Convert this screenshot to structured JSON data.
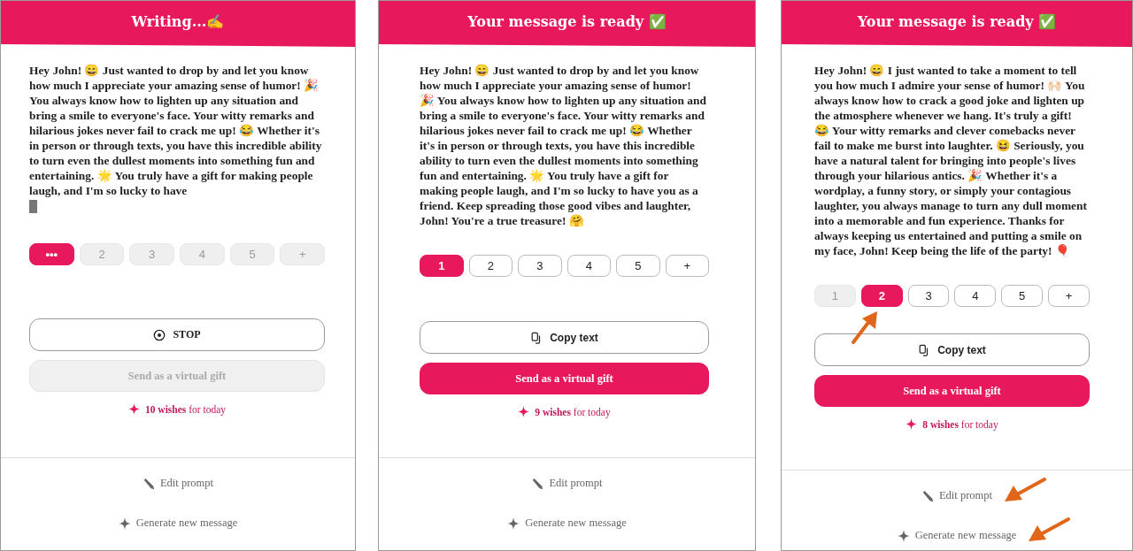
{
  "screens": [
    {
      "title": "Writing...✍️",
      "message": "Hey John! 😄 Just wanted to drop by and let you know how much I appreciate your amazing sense of humor! 🎉 You always know how to lighten up any situation and bring a smile to everyone's face. Your witty remarks and hilarious jokes never fail to crack me up! 😂 Whether it's in person or through texts, you have this incredible ability to turn even the dullest moments into something fun and entertaining. 🌟 You truly have a gift for making people laugh, and I'm so lucky to have",
      "typing": true,
      "versions": [
        {
          "label": "•••",
          "selected": true,
          "disabled": false
        },
        {
          "label": "2",
          "selected": false,
          "disabled": true
        },
        {
          "label": "3",
          "selected": false,
          "disabled": true
        },
        {
          "label": "4",
          "selected": false,
          "disabled": true
        },
        {
          "label": "5",
          "selected": false,
          "disabled": true
        },
        {
          "label": "+",
          "selected": false,
          "disabled": true
        }
      ],
      "action": {
        "kind": "stop",
        "label": "STOP"
      },
      "gift": {
        "label": "Send as a virtual gift",
        "disabled": true
      },
      "wishes": "**10 wishes** for today",
      "links": [
        {
          "kind": "edit",
          "label": "Edit prompt"
        },
        {
          "kind": "generate",
          "label": "Generate new message"
        }
      ]
    },
    {
      "title": "Your message is ready ✅",
      "message": "Hey John! 😄 Just wanted to drop by and let you know how much I appreciate your amazing sense of humor! 🎉 You always know how to lighten up any situation and bring a smile to everyone's face. Your witty remarks and hilarious jokes never fail to crack me up! 😂 Whether it's in person or through texts, you have this incredible ability to turn even the dullest moments into something fun and entertaining. 🌟 You truly have a gift for making people laugh, and I'm so lucky to have you as a friend. Keep spreading those good vibes and laughter, John! You're a true treasure! 🤗",
      "typing": false,
      "versions": [
        {
          "label": "1",
          "selected": true,
          "disabled": false
        },
        {
          "label": "2",
          "selected": false,
          "disabled": false
        },
        {
          "label": "3",
          "selected": false,
          "disabled": false
        },
        {
          "label": "4",
          "selected": false,
          "disabled": false
        },
        {
          "label": "5",
          "selected": false,
          "disabled": false
        },
        {
          "label": "+",
          "selected": false,
          "disabled": false
        }
      ],
      "action": {
        "kind": "copy",
        "label": "Copy text"
      },
      "gift": {
        "label": "Send as a virtual gift",
        "disabled": false
      },
      "wishes": "**9 wishes** for today",
      "links": [
        {
          "kind": "edit",
          "label": "Edit prompt"
        },
        {
          "kind": "generate",
          "label": "Generate new message"
        }
      ]
    },
    {
      "title": "Your message is ready ✅",
      "message": "Hey John! 😄 I just wanted to take a moment to tell you how much I admire your sense of humor! 🙌🏻 You always know how to crack a good joke and lighten up the atmosphere whenever we hang. It's truly a gift! 😂 Your witty remarks and clever comebacks never fail to make me burst into laughter. 😆 Seriously, you have a natural talent for bringing into people's lives through your hilarious antics. 🎉 Whether it's a wordplay, a funny story, or simply your contagious laughter, you always manage to turn any dull moment into a memorable and fun experience. Thanks for always keeping us entertained and putting a smile on my face, John! Keep being the life of the party! 🎈",
      "typing": false,
      "versions": [
        {
          "label": "1",
          "selected": false,
          "disabled": true
        },
        {
          "label": "2",
          "selected": true,
          "disabled": false
        },
        {
          "label": "3",
          "selected": false,
          "disabled": false
        },
        {
          "label": "4",
          "selected": false,
          "disabled": false
        },
        {
          "label": "5",
          "selected": false,
          "disabled": false
        },
        {
          "label": "+",
          "selected": false,
          "disabled": false
        }
      ],
      "action": {
        "kind": "copy",
        "label": "Copy text"
      },
      "gift": {
        "label": "Send as a virtual gift",
        "disabled": false
      },
      "wishes": "**8 wishes** for today",
      "links": [
        {
          "kind": "edit",
          "label": "Edit prompt"
        },
        {
          "kind": "generate",
          "label": "Generate new message"
        }
      ],
      "annotations": [
        {
          "kind": "version-arrow"
        },
        {
          "kind": "edit-arrow"
        },
        {
          "kind": "generate-arrow"
        }
      ]
    }
  ]
}
